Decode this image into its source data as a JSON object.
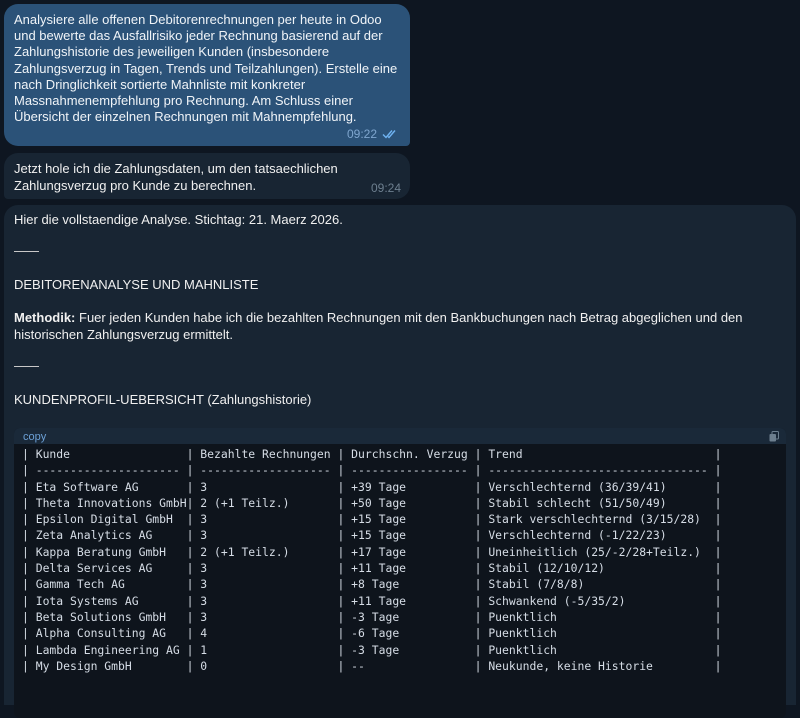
{
  "messages": {
    "user": {
      "text": "Analysiere alle offenen Debitorenrechnungen per heute in Odoo und bewerte das Ausfallrisiko jeder Rechnung basierend auf der Zahlungshistorie des jeweiligen Kunden (insbesondere Zahlungsverzug in Tagen, Trends und Teilzahlungen). Erstelle eine nach Dringlichkeit sortierte Mahnliste mit konkreter Massnahmenempfehlung pro Rechnung. Am Schluss einer Übersicht der einzelnen Rechnungen mit Mahnempfehlung.",
      "time": "09:22"
    },
    "bot1": {
      "text": "Jetzt hole ich die Zahlungsdaten, um den tatsaechlichen Zahlungsverzug pro Kunde zu berechnen.",
      "time": "09:24"
    },
    "bot2": {
      "intro": "Hier die vollstaendige Analyse. Stichtag: 21. Maerz 2026.",
      "heading1": "DEBITORENANALYSE UND MAHNLISTE",
      "method_label": "Methodik:",
      "method_text": " Fuer jeden Kunden habe ich die bezahlten Rechnungen mit den Bankbuchungen nach Betrag abgeglichen und den historischen Zahlungsverzug ermittelt.",
      "heading2": "KUNDENPROFIL-UEBERSICHT (Zahlungshistorie)",
      "code_lang": "copy",
      "table_lines": [
        "| Kunde                 | Bezahlte Rechnungen | Durchschn. Verzug | Trend                            |",
        "| --------------------- | ------------------- | ----------------- | -------------------------------- |",
        "| Eta Software AG       | 3                   | +39 Tage          | Verschlechternd (36/39/41)       |",
        "| Theta Innovations GmbH| 2 (+1 Teilz.)       | +50 Tage          | Stabil schlecht (51/50/49)       |",
        "| Epsilon Digital GmbH  | 3                   | +15 Tage          | Stark verschlechternd (3/15/28)  |",
        "| Zeta Analytics AG     | 3                   | +15 Tage          | Verschlechternd (-1/22/23)       |",
        "| Kappa Beratung GmbH   | 2 (+1 Teilz.)       | +17 Tage          | Uneinheitlich (25/-2/28+Teilz.)  |",
        "| Delta Services AG     | 3                   | +11 Tage          | Stabil (12/10/12)                |",
        "| Gamma Tech AG         | 3                   | +8 Tage           | Stabil (7/8/8)                   |",
        "| Iota Systems AG       | 3                   | +11 Tage          | Schwankend (-5/35/2)             |",
        "| Beta Solutions GmbH   | 3                   | -3 Tage           | Puenktlich                       |",
        "| Alpha Consulting AG   | 4                   | -6 Tage           | Puenktlich                       |",
        "| Lambda Engineering AG | 1                   | -3 Tage           | Puenktlich                       |",
        "| My Design GmbH        | 0                   | --                | Neukunde, keine Historie         |"
      ]
    }
  },
  "colors": {
    "background": "#0e1621",
    "outgoing": "#2b5278",
    "incoming": "#182533",
    "code_bg": "#0e141c"
  }
}
